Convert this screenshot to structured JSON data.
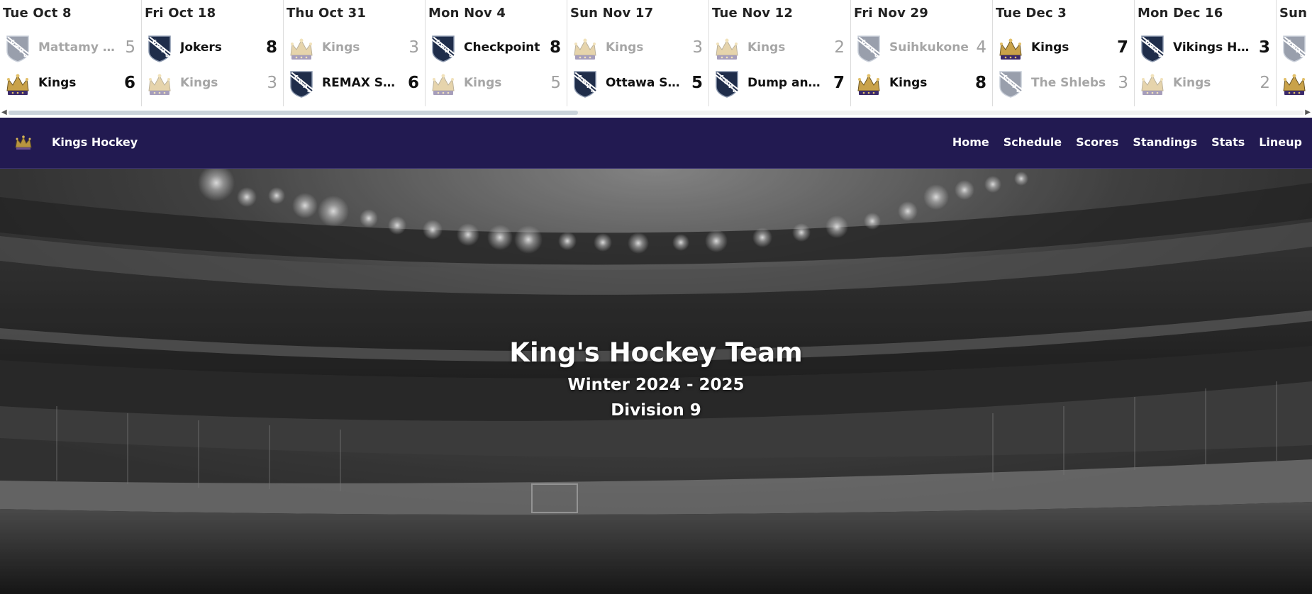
{
  "scores_strip": {
    "scroll_left_icon": "chevron-left-icon",
    "scroll_right_icon": "chevron-right-icon",
    "scroll_position": 0.44,
    "games": [
      {
        "date": "Tue Oct 8",
        "teams": [
          {
            "name": "Mattamy Homes",
            "score": "5",
            "logo": "crhl",
            "winner": false
          },
          {
            "name": "Kings",
            "score": "6",
            "logo": "kings",
            "winner": true
          }
        ]
      },
      {
        "date": "Fri Oct 18",
        "teams": [
          {
            "name": "Jokers",
            "score": "8",
            "logo": "crhl",
            "winner": true
          },
          {
            "name": "Kings",
            "score": "3",
            "logo": "kings",
            "winner": false
          }
        ]
      },
      {
        "date": "Thu Oct 31",
        "teams": [
          {
            "name": "Kings",
            "score": "3",
            "logo": "kings",
            "winner": false
          },
          {
            "name": "REMAX Select",
            "score": "6",
            "logo": "crhl",
            "winner": true
          }
        ]
      },
      {
        "date": "Mon Nov 4",
        "teams": [
          {
            "name": "Checkpoint",
            "score": "8",
            "logo": "crhl",
            "winner": true
          },
          {
            "name": "Kings",
            "score": "5",
            "logo": "kings",
            "winner": false
          }
        ]
      },
      {
        "date": "Sun Nov 17",
        "teams": [
          {
            "name": "Kings",
            "score": "3",
            "logo": "kings",
            "winner": false
          },
          {
            "name": "Ottawa Sports",
            "score": "5",
            "logo": "crhl",
            "winner": true
          }
        ]
      },
      {
        "date": "Tue Nov 12",
        "teams": [
          {
            "name": "Kings",
            "score": "2",
            "logo": "kings",
            "winner": false
          },
          {
            "name": "Dump and Chase",
            "score": "7",
            "logo": "crhl",
            "winner": true
          }
        ]
      },
      {
        "date": "Fri Nov 29",
        "teams": [
          {
            "name": "Suihkukone",
            "score": "4",
            "logo": "crhl",
            "winner": false
          },
          {
            "name": "Kings",
            "score": "8",
            "logo": "kings",
            "winner": true
          }
        ]
      },
      {
        "date": "Tue Dec 3",
        "teams": [
          {
            "name": "Kings",
            "score": "7",
            "logo": "kings",
            "winner": true
          },
          {
            "name": "The Shlebs",
            "score": "3",
            "logo": "crhl",
            "winner": false
          }
        ]
      },
      {
        "date": "Mon Dec 16",
        "teams": [
          {
            "name": "Vikings Hockey",
            "score": "3",
            "logo": "crhl",
            "winner": true
          },
          {
            "name": "Kings",
            "score": "2",
            "logo": "kings",
            "winner": false
          }
        ]
      },
      {
        "date": "Sun Dec",
        "teams": [
          {
            "name": "",
            "score": "",
            "logo": "crhl",
            "winner": false
          },
          {
            "name": "",
            "score": "",
            "logo": "kings",
            "winner": true
          }
        ]
      }
    ]
  },
  "navbar": {
    "brand_icon": "crown-icon",
    "brand_name": "Kings Hockey",
    "links": [
      "Home",
      "Schedule",
      "Scores",
      "Standings",
      "Stats",
      "Lineup"
    ],
    "background": "#221a51"
  },
  "hero": {
    "title": "King's Hockey Team",
    "season": "Winter 2024 - 2025",
    "division": "Division 9",
    "image": "arena-background"
  },
  "colors": {
    "kings_gold": "#c9a24a",
    "kings_purple": "#3b2a6b",
    "crhl_navy": "#1f2d4a"
  }
}
